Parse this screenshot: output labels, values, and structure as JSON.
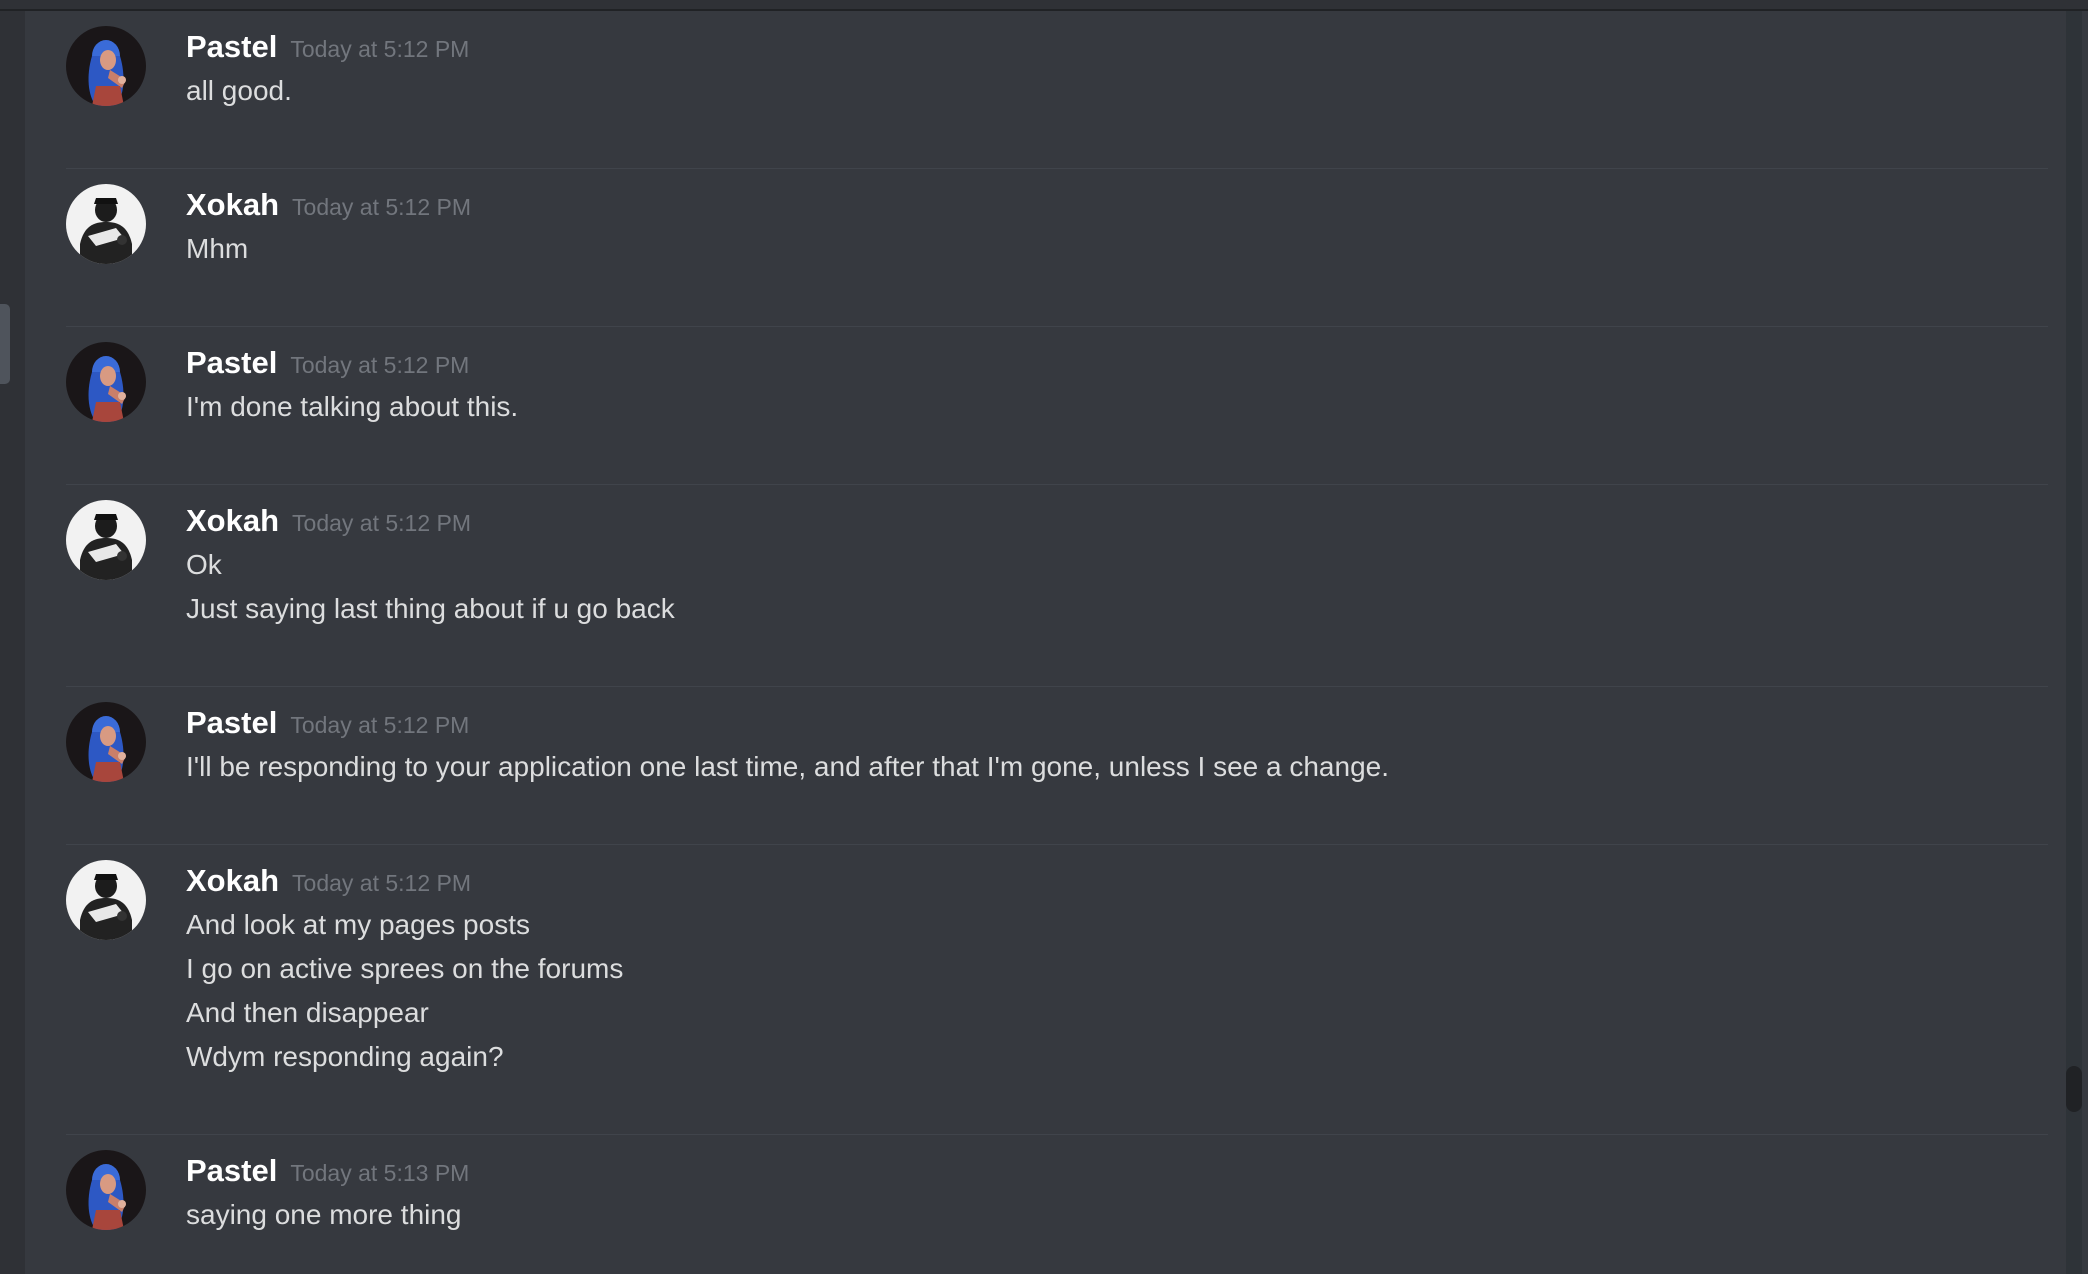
{
  "colors": {
    "background": "#36393f",
    "sidebar": "#2f3136",
    "username": "#ffffff",
    "timestamp": "#72767d",
    "message_text": "#dcddde",
    "divider": "#40444b"
  },
  "messages": [
    {
      "author": "Pastel",
      "avatar_icon": "pastel-avatar-icon",
      "timestamp": "Today at 5:12 PM",
      "lines": [
        "all good."
      ]
    },
    {
      "author": "Xokah",
      "avatar_icon": "xokah-avatar-icon",
      "timestamp": "Today at 5:12 PM",
      "lines": [
        "Mhm"
      ]
    },
    {
      "author": "Pastel",
      "avatar_icon": "pastel-avatar-icon",
      "timestamp": "Today at 5:12 PM",
      "lines": [
        "I'm done talking about this."
      ]
    },
    {
      "author": "Xokah",
      "avatar_icon": "xokah-avatar-icon",
      "timestamp": "Today at 5:12 PM",
      "lines": [
        "Ok",
        "Just saying last thing about if u go back"
      ]
    },
    {
      "author": "Pastel",
      "avatar_icon": "pastel-avatar-icon",
      "timestamp": "Today at 5:12 PM",
      "lines": [
        "I'll be responding to your application one last time, and after that I'm gone, unless I see a change."
      ]
    },
    {
      "author": "Xokah",
      "avatar_icon": "xokah-avatar-icon",
      "timestamp": "Today at 5:12 PM",
      "lines": [
        "And look at my pages posts",
        "I go on active sprees on the forums",
        "And then disappear",
        "Wdym responding again?"
      ]
    },
    {
      "author": "Pastel",
      "avatar_icon": "pastel-avatar-icon",
      "timestamp": "Today at 5:13 PM",
      "lines": [
        "saying one more thing"
      ]
    }
  ]
}
